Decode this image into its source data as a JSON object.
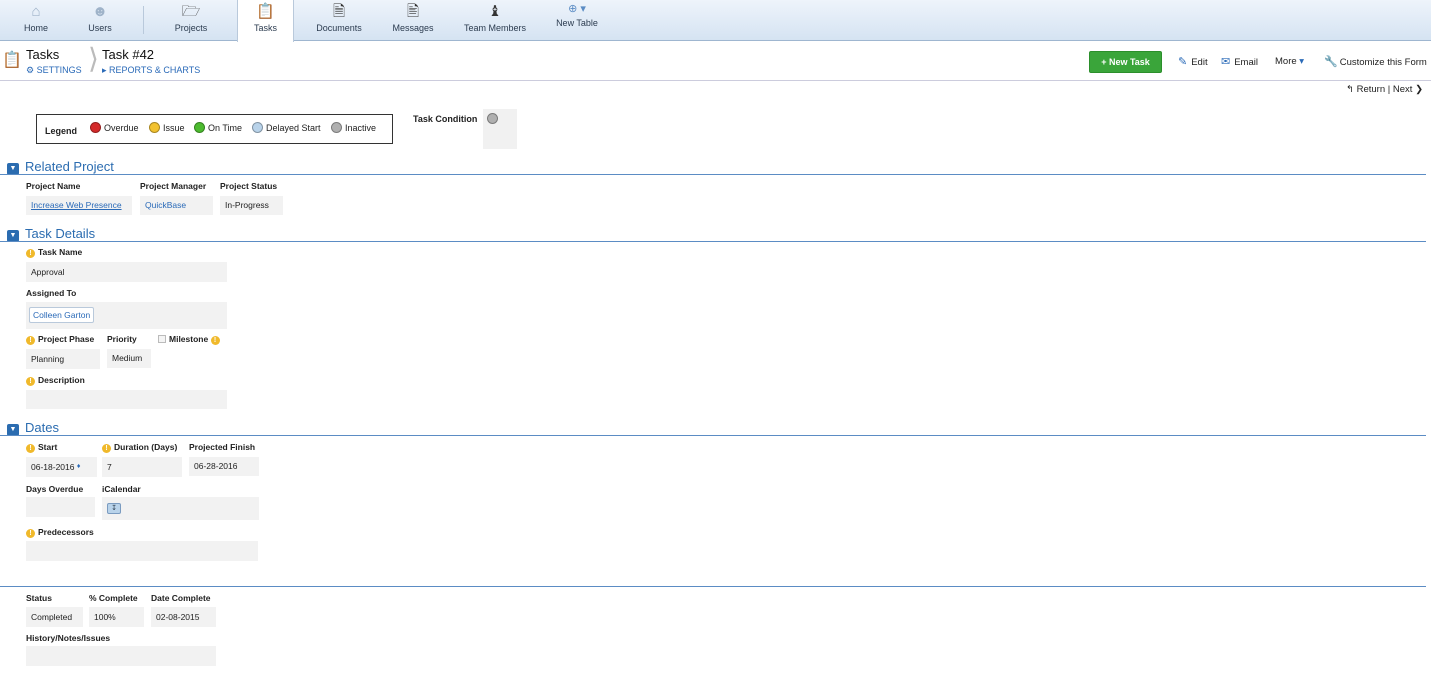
{
  "nav": {
    "items": [
      {
        "label": "Home",
        "icon": "home-icon"
      },
      {
        "label": "Users",
        "icon": "users-icon"
      },
      {
        "label": "Projects",
        "icon": "folder-icon"
      },
      {
        "label": "Tasks",
        "icon": "clipboard-icon"
      },
      {
        "label": "Documents",
        "icon": "documents-icon"
      },
      {
        "label": "Messages",
        "icon": "messages-icon"
      },
      {
        "label": "Team Members",
        "icon": "chess-piece-icon"
      },
      {
        "label": "New Table",
        "icon": "plus-circle-icon"
      }
    ],
    "active": "Tasks"
  },
  "header": {
    "section_title": "Tasks",
    "settings_label": "SETTINGS",
    "record_title": "Task #42",
    "reports_label": "REPORTS & CHARTS",
    "new_task_label": "+ New Task",
    "edit_label": "Edit",
    "email_label": "Email",
    "more_label": "More",
    "customize_label": "Customize this Form",
    "return_label": "Return",
    "next_label": "Next",
    "return_sep": "|"
  },
  "legend": {
    "title": "Legend",
    "items": [
      {
        "label": "Overdue",
        "color": "#d42a2a"
      },
      {
        "label": "Issue",
        "color": "#f2c230"
      },
      {
        "label": "On Time",
        "color": "#4cbb2f"
      },
      {
        "label": "Delayed Start",
        "color": "#b9d3ea"
      },
      {
        "label": "Inactive",
        "color": "#b0b0b0"
      }
    ]
  },
  "task_condition": {
    "label": "Task Condition",
    "color": "#b0b0b0"
  },
  "related_project": {
    "title": "Related Project",
    "project_name_label": "Project Name",
    "project_name": "Increase Web Presence",
    "project_manager_label": "Project Manager",
    "project_manager": "QuickBase",
    "project_status_label": "Project Status",
    "project_status": "In-Progress"
  },
  "task_details": {
    "title": "Task Details",
    "task_name_label": "Task Name",
    "task_name": "Approval",
    "assigned_to_label": "Assigned To",
    "assigned_to": "Colleen Garton",
    "project_phase_label": "Project Phase",
    "project_phase": "Planning",
    "priority_label": "Priority",
    "priority": "Medium",
    "milestone_label": "Milestone",
    "milestone_checked": false,
    "description_label": "Description",
    "description": ""
  },
  "dates": {
    "title": "Dates",
    "start_label": "Start",
    "start": "06-18-2016",
    "duration_label": "Duration (Days)",
    "duration": "7",
    "projected_finish_label": "Projected Finish",
    "projected_finish": "06-28-2016",
    "days_overdue_label": "Days Overdue",
    "days_overdue": "",
    "icalendar_label": "iCalendar",
    "predecessors_label": "Predecessors",
    "predecessors": ""
  },
  "status_section": {
    "status_label": "Status",
    "status": "Completed",
    "percent_label": "% Complete",
    "percent": "100%",
    "date_complete_label": "Date Complete",
    "date_complete": "02-08-2015",
    "history_label": "History/Notes/Issues",
    "history": ""
  }
}
